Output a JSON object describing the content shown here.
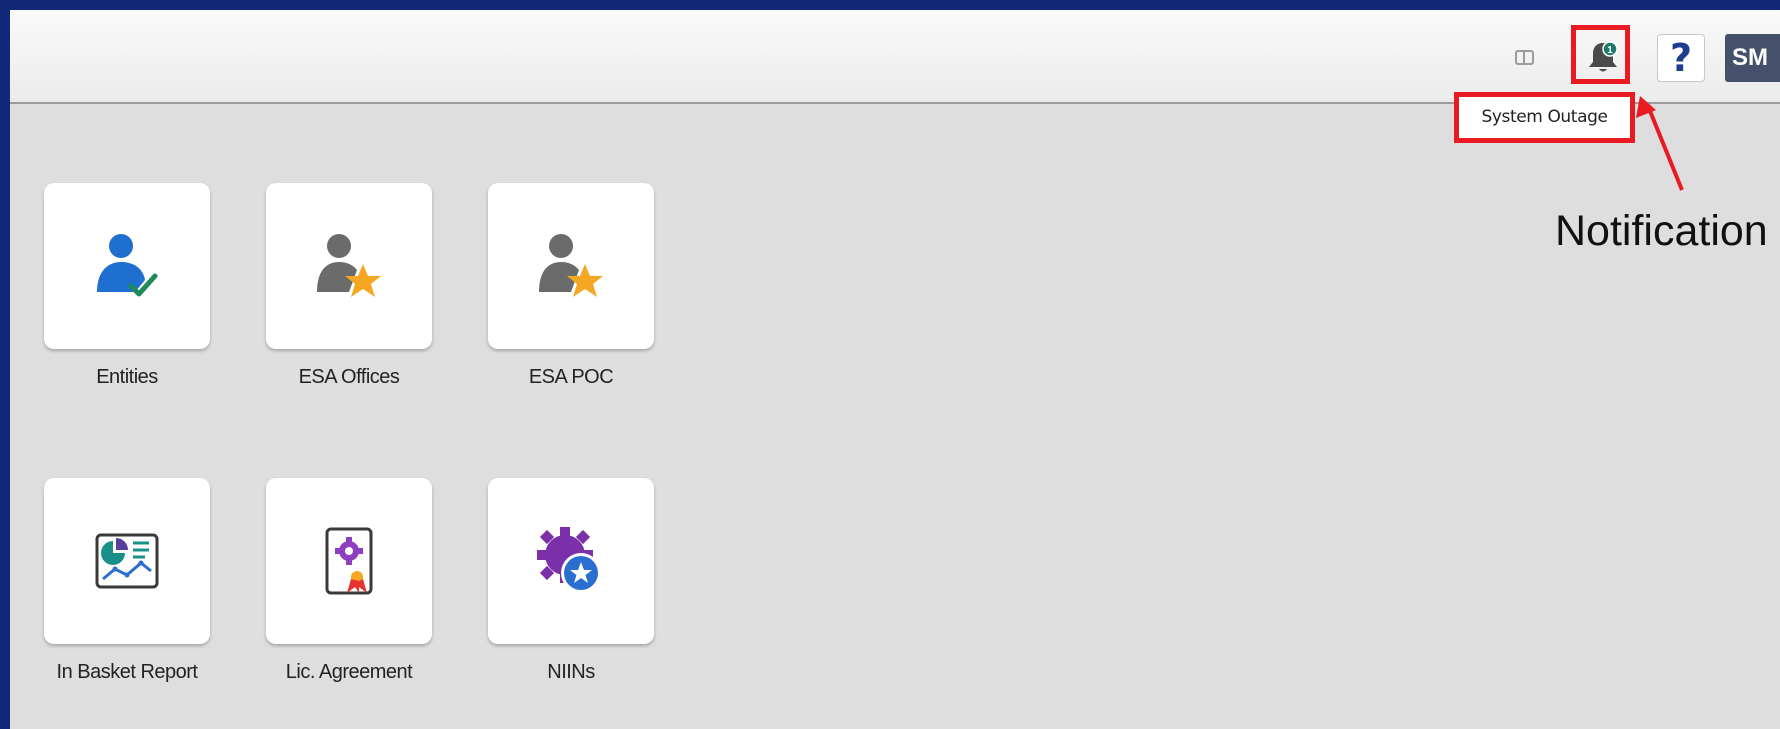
{
  "header": {
    "buttons": {
      "panel_icon": "split-panel-icon",
      "notifications_icon": "bell-icon",
      "notification_count": "1",
      "help_label": "?",
      "user_initials": "SM"
    },
    "tooltip": "System Outage"
  },
  "annotation": {
    "label": "Notification",
    "highlight_color": "#e81b23"
  },
  "tiles": [
    {
      "label": "Entities",
      "icon": "user-check-icon"
    },
    {
      "label": "ESA Offices",
      "icon": "user-star-icon"
    },
    {
      "label": "ESA POC",
      "icon": "user-star-icon"
    },
    {
      "label": "In Basket Report",
      "icon": "report-chart-icon"
    },
    {
      "label": "Lic. Agreement",
      "icon": "certificate-icon"
    },
    {
      "label": "NIINs",
      "icon": "gear-star-icon"
    }
  ],
  "colors": {
    "frame_border": "#14287a",
    "background": "#dedede",
    "avatar_bg": "#45506b",
    "help_color": "#1f3d8f"
  }
}
